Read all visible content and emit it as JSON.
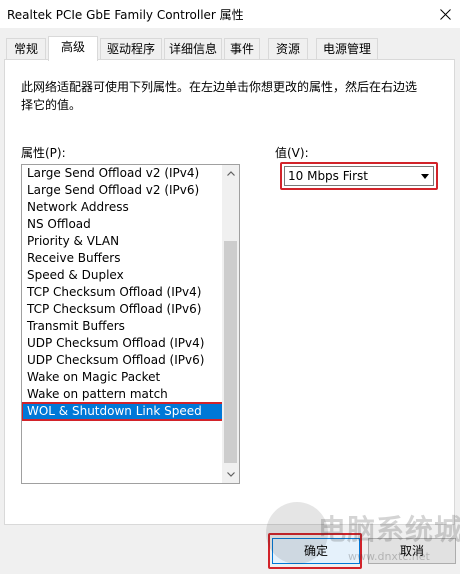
{
  "window": {
    "title": "Realtek PCIe GbE Family Controller 属性",
    "close_icon": "close-icon"
  },
  "tabs": [
    {
      "label": "常规"
    },
    {
      "label": "高级",
      "active": true
    },
    {
      "label": "驱动程序"
    },
    {
      "label": "详细信息"
    },
    {
      "label": "事件"
    },
    {
      "label": "资源"
    },
    {
      "label": "电源管理"
    }
  ],
  "advanced": {
    "description": "此网络适配器可使用下列属性。在左边单击你想更改的属性，然后在右边选择它的值。",
    "property_label": "属性(P):",
    "value_label": "值(V):",
    "properties": [
      "Large Send Offload v2 (IPv4)",
      "Large Send Offload v2 (IPv6)",
      "Network Address",
      "NS Offload",
      "Priority & VLAN",
      "Receive Buffers",
      "Speed & Duplex",
      "TCP Checksum Offload (IPv4)",
      "TCP Checksum Offload (IPv6)",
      "Transmit Buffers",
      "UDP Checksum Offload (IPv4)",
      "UDP Checksum Offload (IPv6)",
      "Wake on Magic Packet",
      "Wake on pattern match",
      "WOL & Shutdown Link Speed"
    ],
    "selected_property": "WOL & Shutdown Link Speed",
    "selected_value": "10 Mbps First",
    "highlight_color": "#d2232a",
    "selection_color": "#0078d7"
  },
  "buttons": {
    "ok_label": "确定",
    "cancel_label": "取消"
  },
  "watermark": {
    "text": "电脑系统城",
    "url": "www.dnxtc.net"
  }
}
